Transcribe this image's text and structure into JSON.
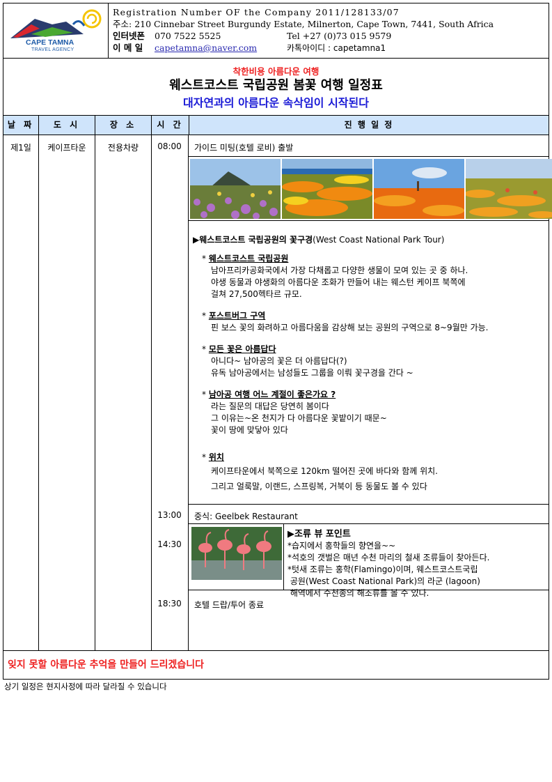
{
  "company": {
    "logo_name": "CAPE TAMNA",
    "logo_sub": "TRAVEL AGENCY",
    "registration": "Registration Number OF the Company 2011/128133/07",
    "address_label": "주소:",
    "address": "210 Cinnebar Street Burgundy Estate, Milnerton, Cape Town, 7441, South Africa",
    "phone_label": "인터넷폰",
    "phone": "070 7522 5525",
    "tel": "Tel +27 (0)73 015 9579",
    "email_label": "이 메 일",
    "email": "capetamna@naver.com",
    "kakao": "카톡아이디 : capetamna1"
  },
  "titles": {
    "t1": "착한비용 아름다운 여행",
    "t2": "웨스트코스트 국립공원 봄꽃 여행 일정표",
    "t3": "대자연과의 아름다운 속삭임이 시작된다"
  },
  "table": {
    "headers": [
      "날 짜",
      "도 시",
      "장 소",
      "시 간",
      "진 행 일 정"
    ],
    "day": "제1일",
    "city": "케이프타운",
    "place": "전용차량",
    "rows": [
      {
        "time": "08:00",
        "text": "가이드 미팅(호텔 로비) 출발"
      },
      {
        "time": "13:00",
        "text": "중식: Geelbek Restaurant"
      },
      {
        "time": "14:30"
      },
      {
        "time": "18:30",
        "text": "호텔 드랍/투어 종료"
      }
    ]
  },
  "tour": {
    "heading_bold": "▶웨스트코스트 국립공원의 꽃구경",
    "heading_rest": "(West Coast National Park Tour)",
    "sections": [
      {
        "title": "웨스트코스트 국립공원",
        "lines": [
          "남아프리카공화국에서 가장 다채롭고 다양한 생물이 모여 있는 곳 중 하나.",
          "야생 동물과 야생화의 아름다운 조화가 만들어 내는 웨스턴 케이프 북쪽에",
          "걸쳐 27,500헥타르 규모."
        ]
      },
      {
        "title": "포스트버그 구역",
        "lines": [
          "핀 보스 꽃의 화려하고 아름다움을 감상해 보는 공원의 구역으로 8~9월만 가능."
        ]
      },
      {
        "title": "모든 꽃은 아름답다",
        "lines": [
          "아니다~ 남아공의 꽃은 더 아름답다(?)",
          "유독 남아공에서는 남성들도 그룹을 이뤄 꽃구경을 간다 ~"
        ]
      },
      {
        "title": "남아공 여행 어느 계절이 좋은가요 ?",
        "lines": [
          "라는 질문의 대답은 당연히 봄이다",
          "그 이유는~온 천지가 다 아름다운 꽃밭이기 때문~",
          "꽃이 땅에 맞닿아 있다"
        ]
      },
      {
        "title": "위치",
        "lines": [
          "케이프타운에서 북쪽으로 120km 떨어진 곳에 바다와 함께 위치.",
          "그리고 얼룩말, 이랜드, 스프링복, 거북이 등 동물도 볼 수 있다"
        ]
      }
    ],
    "bullet": "*"
  },
  "bird": {
    "title": "▶조류 뷰 포인트",
    "lines": [
      "*습지에서 홍학들의 향연을~~",
      "*석호의 갯벌은 매년 수천 마리의 철새 조류들이 찾아든다.",
      "*텃새 조류는 홍학(Flamingo)이며, 웨스트코스트국립",
      " 공원(West Coast National Park)의 라군 (lagoon)",
      " 해역에서 수천종의 해조류를 볼 수 있다."
    ]
  },
  "closing": "잊지 못할 아름다운 추억을 만들어 드리겠습니다",
  "note": "상기 일정은 현지사정에 따라 달라질 수 있습니다"
}
